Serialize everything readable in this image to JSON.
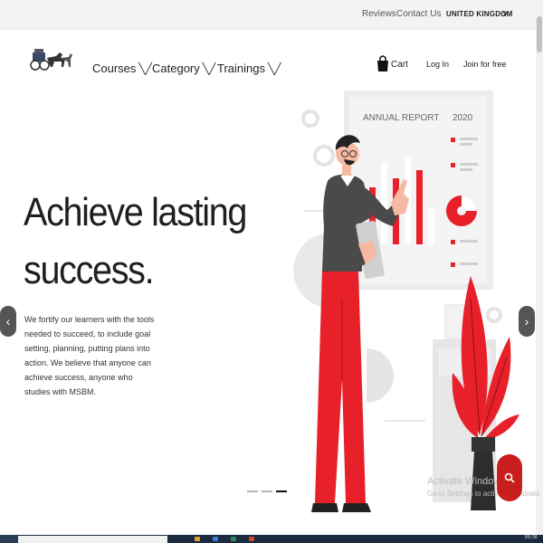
{
  "topbar": {
    "reviews": "Reviews",
    "contact": "Contact Us",
    "country": "UNITED KINGDOM",
    "country_chevron": "v"
  },
  "nav": {
    "logo_icon": "carriage-logo-icon",
    "menu": [
      {
        "label": "Courses",
        "caret": "╲╱"
      },
      {
        "label": "Category",
        "caret": "╲╱"
      },
      {
        "label": "Trainings",
        "caret": "╲╱"
      }
    ],
    "cart_label": "Cart",
    "login_label": "Log In",
    "join_label": "Join for free"
  },
  "hero": {
    "title_line1": "Achieve lasting",
    "title_line2": "success.",
    "body": "We fortify our learners with the tools needed to succeed, to include goal setting, planning, putting plans into action. We believe that anyone can achieve success, anyone who studies with MSBM."
  },
  "carousel": {
    "prev_icon": "‹",
    "next_icon": "›",
    "slide_count": 3,
    "active_slide": 3
  },
  "illustration": {
    "report_title": "ANNUAL REPORT",
    "report_year": "2020",
    "accent": "#e8202a"
  },
  "watermark": {
    "line1": "Activate Windows",
    "line2": "Go to Settings to activate Windows."
  },
  "taskbar": {
    "tray_text": "09:36"
  }
}
